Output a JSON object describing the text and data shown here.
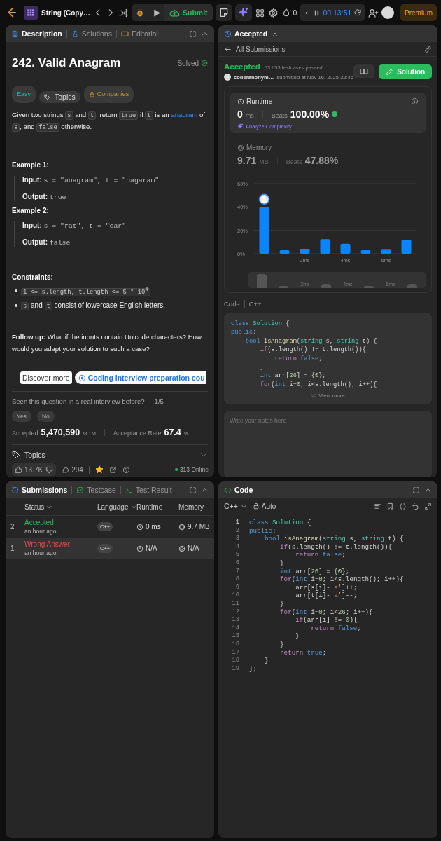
{
  "top_bar": {
    "problem_list": "String (Copy…",
    "submit": "Submit",
    "streak": "0",
    "timer": "00:13:51",
    "premium": "Premium"
  },
  "description_panel": {
    "tabs": [
      {
        "label": "Description",
        "selected": true
      },
      {
        "label": "Solutions",
        "selected": false
      },
      {
        "label": "Editorial",
        "selected": false
      }
    ],
    "title": "242. Valid Anagram",
    "status": "Solved",
    "tags": [
      {
        "label": "Easy",
        "kind": "difficulty"
      },
      {
        "label": "Topics",
        "kind": "topics"
      },
      {
        "label": "Companies",
        "kind": "companies"
      }
    ],
    "statement": [
      {
        "kind": "text",
        "text": "Given two strings "
      },
      {
        "kind": "code",
        "text": "s"
      },
      {
        "kind": "text",
        "text": " and "
      },
      {
        "kind": "code",
        "text": "t"
      },
      {
        "kind": "text",
        "text": ", return "
      },
      {
        "kind": "code",
        "text": "true"
      },
      {
        "kind": "text",
        "text": " if "
      },
      {
        "kind": "code",
        "text": "t"
      },
      {
        "kind": "text",
        "text": " is an "
      },
      {
        "kind": "link",
        "text": "anagram"
      },
      {
        "kind": "text",
        "text": " of "
      },
      {
        "kind": "code",
        "text": "s"
      },
      {
        "kind": "text",
        "text": ", and "
      },
      {
        "kind": "code",
        "text": "false"
      },
      {
        "kind": "text",
        "text": " otherwise."
      }
    ],
    "examples": [
      {
        "heading": "Example 1:",
        "input_label": "Input:",
        "input": "s = \"anagram\", t = \"nagaram\"",
        "output_label": "Output:",
        "output": "true"
      },
      {
        "heading": "Example 2:",
        "input_label": "Input:",
        "input": "s = \"rat\", t = \"car\"",
        "output_label": "Output:",
        "output": "false"
      }
    ],
    "constraints_heading": "Constraints:",
    "constraints": [
      [
        {
          "kind": "code",
          "text": "1 <= s.length, t.length <= 5 * 10$^{4}$"
        }
      ],
      [
        {
          "kind": "code",
          "text": "s"
        },
        {
          "kind": "text",
          "text": " and "
        },
        {
          "kind": "code",
          "text": "t"
        },
        {
          "kind": "text",
          "text": " consist of lowercase English letters."
        }
      ]
    ],
    "follow_up": "**Follow up:** What if the inputs contain Unicode characters? How would you adapt your solution to such a case?",
    "ad": {
      "discover": "Discover more",
      "link": "Coding interview preparation cou"
    },
    "interview": {
      "question": "Seen this question in a real interview before?",
      "count": "1/5",
      "buttons": [
        "Yes",
        "No"
      ]
    },
    "stats": {
      "accepted_label": "Accepted",
      "accepted": "5,470,590",
      "submissions": "/8.1M",
      "rate_label": "Acceptance Rate",
      "rate": "67.4",
      "rate_unit": "%"
    },
    "topics": {
      "label": "Topics",
      "expanded": false
    },
    "footer": {
      "likes": "13.7K",
      "comments": "294",
      "favorited": true,
      "online": "313 Online"
    }
  },
  "submission_panel": {
    "tab": "Accepted",
    "back": "All Submissions",
    "result": "Accepted",
    "testcases": "53 / 53 testcases passed",
    "user": "coderanonym…",
    "submitted": "submitted at Nov 16, 2025 22:45",
    "solution_button": "Solution",
    "metrics": [
      {
        "kind": "runtime",
        "label": "Runtime",
        "value": "0",
        "unit": "ms",
        "beats_label": "Beats",
        "beats": "100.00%",
        "selected": true,
        "action": "Analyze Complexity"
      },
      {
        "kind": "memory",
        "label": "Memory",
        "value": "9.71",
        "unit": "MB",
        "beats_label": "Beats",
        "beats": "47.88%",
        "selected": false
      }
    ],
    "chart_data": {
      "type": "bar",
      "x": [
        0,
        1,
        2,
        3,
        4,
        5,
        6,
        7
      ],
      "xlim": [
        -0.5,
        7.5
      ],
      "ylim": [
        0,
        60
      ],
      "series": [
        {
          "color": "#0a84ff",
          "values": [
            40,
            3,
            4,
            12.5,
            8.5,
            3,
            3.5,
            12
          ]
        }
      ],
      "xticks": [
        {
          "value": 2,
          "label": "2ms"
        },
        {
          "value": 4,
          "label": "4ms"
        },
        {
          "value": 6,
          "label": "6ms"
        }
      ],
      "yticks": [
        {
          "value": 0,
          "label": "0%"
        },
        {
          "value": 20,
          "label": "20%"
        },
        {
          "value": 40,
          "label": "40%"
        },
        {
          "value": 60,
          "label": "60%"
        }
      ]
    },
    "overview_labels": [
      "2ms",
      "4ms",
      "6ms"
    ],
    "code_label": "Code",
    "language": "C++",
    "code_preview": [
      [
        {
          "kind": "kw",
          "text": "class "
        },
        {
          "kind": "ty",
          "text": "Solution"
        },
        {
          "kind": "p",
          "text": " {"
        }
      ],
      [
        {
          "kind": "kw",
          "text": "public"
        },
        {
          "kind": "p",
          "text": ":"
        }
      ],
      [
        {
          "kind": "kw",
          "text": "    bool "
        },
        {
          "kind": "fn",
          "text": "isAnagram"
        },
        {
          "kind": "p",
          "text": "("
        },
        {
          "kind": "ty",
          "text": "string"
        },
        {
          "kind": "p",
          "text": " s, "
        },
        {
          "kind": "ty",
          "text": "string"
        },
        {
          "kind": "p",
          "text": " t) {"
        }
      ],
      [
        {
          "kind": "ctl",
          "text": "        if"
        },
        {
          "kind": "p",
          "text": "(s.length() != t.length()){"
        }
      ],
      [
        {
          "kind": "ctl",
          "text": "            return "
        },
        {
          "kind": "kw",
          "text": "false"
        },
        {
          "kind": "p",
          "text": ";"
        }
      ],
      [
        {
          "kind": "p",
          "text": "        }"
        }
      ],
      [
        {
          "kind": "kw",
          "text": "        int "
        },
        {
          "kind": "p",
          "text": "arr["
        },
        {
          "kind": "num",
          "text": "26"
        },
        {
          "kind": "p",
          "text": "] = {"
        },
        {
          "kind": "num",
          "text": "0"
        },
        {
          "kind": "p",
          "text": "};"
        }
      ],
      [
        {
          "kind": "ctl",
          "text": "        for"
        },
        {
          "kind": "p",
          "text": "("
        },
        {
          "kind": "kw",
          "text": "int "
        },
        {
          "kind": "p",
          "text": "i="
        },
        {
          "kind": "num",
          "text": "0"
        },
        {
          "kind": "p",
          "text": "; i<s.length(); i++){"
        }
      ]
    ],
    "view_more": "View more",
    "notes": {
      "placeholder": "Write your notes here"
    }
  },
  "submissions_panel": {
    "tabs": [
      {
        "label": "Submissions",
        "selected": true
      },
      {
        "label": "Testcase",
        "selected": false
      },
      {
        "label": "Test Result",
        "selected": false
      }
    ],
    "columns": [
      {
        "label": "Status",
        "sortable": true
      },
      {
        "label": "Language",
        "sortable": true
      },
      {
        "label": "Runtime",
        "sortable": false
      },
      {
        "label": "Memory",
        "sortable": false
      }
    ],
    "rows": [
      {
        "number": "2",
        "status": "Accepted",
        "kind": "accepted",
        "time": "an hour ago",
        "language": "C++",
        "runtime": "0 ms",
        "memory": "9.7 MB",
        "selected": false
      },
      {
        "number": "1",
        "status": "Wrong Answer",
        "kind": "wrong",
        "time": "an hour ago",
        "language": "C++",
        "runtime": "N/A",
        "memory": "N/A",
        "selected": true
      }
    ]
  },
  "code_panel": {
    "title": "Code",
    "language": "C++",
    "mode": "Auto",
    "lines": [
      {
        "number": "1",
        "tokens": [
          {
            "kind": "kw",
            "text": "class "
          },
          {
            "kind": "ty",
            "text": "Solution"
          },
          {
            "kind": "p",
            "text": " {"
          }
        ]
      },
      {
        "number": "2",
        "tokens": [
          {
            "kind": "kw",
            "text": "public"
          },
          {
            "kind": "p",
            "text": ":"
          }
        ]
      },
      {
        "number": "3",
        "tokens": [
          {
            "kind": "kw",
            "text": "    bool "
          },
          {
            "kind": "fn",
            "text": "isAnagram"
          },
          {
            "kind": "p",
            "text": "("
          },
          {
            "kind": "ty",
            "text": "string"
          },
          {
            "kind": "p",
            "text": " s, "
          },
          {
            "kind": "ty",
            "text": "string"
          },
          {
            "kind": "p",
            "text": " t) {"
          }
        ]
      },
      {
        "number": "4",
        "tokens": [
          {
            "kind": "ctl",
            "text": "        if"
          },
          {
            "kind": "p",
            "text": "(s.length() != t.length()){"
          }
        ]
      },
      {
        "number": "5",
        "tokens": [
          {
            "kind": "ctl",
            "text": "            return "
          },
          {
            "kind": "kw",
            "text": "false"
          },
          {
            "kind": "p",
            "text": ";"
          }
        ]
      },
      {
        "number": "6",
        "tokens": [
          {
            "kind": "p",
            "text": "        }"
          }
        ]
      },
      {
        "number": "7",
        "tokens": [
          {
            "kind": "kw",
            "text": "        int "
          },
          {
            "kind": "p",
            "text": "arr["
          },
          {
            "kind": "num",
            "text": "26"
          },
          {
            "kind": "p",
            "text": "] = {"
          },
          {
            "kind": "num",
            "text": "0"
          },
          {
            "kind": "p",
            "text": "};"
          }
        ]
      },
      {
        "number": "8",
        "tokens": [
          {
            "kind": "ctl",
            "text": "        for"
          },
          {
            "kind": "p",
            "text": "("
          },
          {
            "kind": "kw",
            "text": "int "
          },
          {
            "kind": "p",
            "text": "i="
          },
          {
            "kind": "num",
            "text": "0"
          },
          {
            "kind": "p",
            "text": "; i<s.length(); i++){"
          }
        ]
      },
      {
        "number": "9",
        "tokens": [
          {
            "kind": "p",
            "text": "            arr[s[i]-"
          },
          {
            "kind": "str",
            "text": "'a'"
          },
          {
            "kind": "p",
            "text": "]++;"
          }
        ]
      },
      {
        "number": "10",
        "tokens": [
          {
            "kind": "p",
            "text": "            arr[t[i]-"
          },
          {
            "kind": "str",
            "text": "'a'"
          },
          {
            "kind": "p",
            "text": "]--;"
          }
        ]
      },
      {
        "number": "11",
        "tokens": [
          {
            "kind": "p",
            "text": "        }"
          }
        ]
      },
      {
        "number": "12",
        "tokens": [
          {
            "kind": "ctl",
            "text": "        for"
          },
          {
            "kind": "p",
            "text": "("
          },
          {
            "kind": "kw",
            "text": "int "
          },
          {
            "kind": "p",
            "text": "i="
          },
          {
            "kind": "num",
            "text": "0"
          },
          {
            "kind": "p",
            "text": "; i<"
          },
          {
            "kind": "num",
            "text": "26"
          },
          {
            "kind": "p",
            "text": "; i++){"
          }
        ]
      },
      {
        "number": "13",
        "tokens": [
          {
            "kind": "ctl",
            "text": "            if"
          },
          {
            "kind": "p",
            "text": "(arr[i] != "
          },
          {
            "kind": "num",
            "text": "0"
          },
          {
            "kind": "p",
            "text": "){"
          }
        ]
      },
      {
        "number": "14",
        "tokens": [
          {
            "kind": "ctl",
            "text": "                return "
          },
          {
            "kind": "kw",
            "text": "false"
          },
          {
            "kind": "p",
            "text": ";"
          }
        ]
      },
      {
        "number": "15",
        "tokens": [
          {
            "kind": "p",
            "text": "            }"
          }
        ]
      },
      {
        "number": "16",
        "tokens": [
          {
            "kind": "p",
            "text": "        }"
          }
        ]
      },
      {
        "number": "17",
        "tokens": [
          {
            "kind": "ctl",
            "text": "        return "
          },
          {
            "kind": "kw",
            "text": "true"
          },
          {
            "kind": "p",
            "text": ";"
          }
        ]
      },
      {
        "number": "18",
        "tokens": [
          {
            "kind": "p",
            "text": "    }"
          }
        ]
      },
      {
        "number": "19",
        "tokens": [
          {
            "kind": "p",
            "text": "};"
          }
        ]
      }
    ]
  }
}
